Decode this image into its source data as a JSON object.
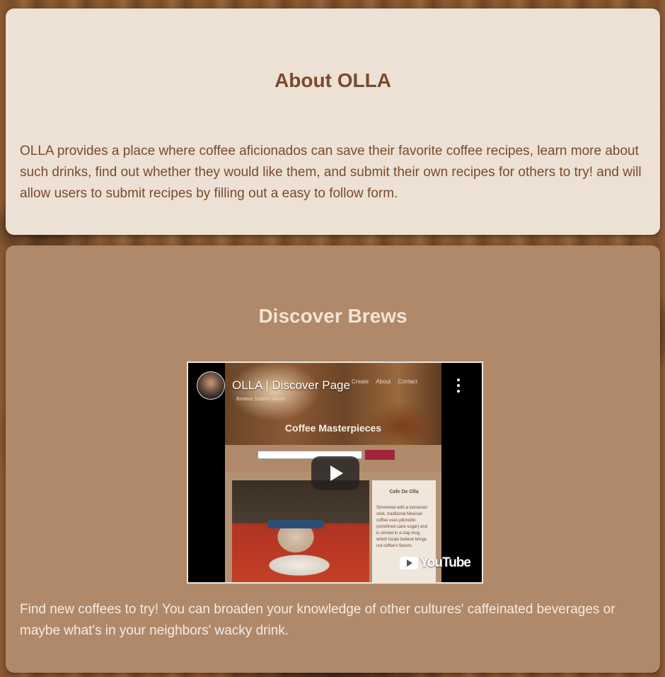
{
  "about": {
    "title": "About OLLA",
    "body": "OLLA provides a place where coffee aficionados can save their favorite coffee recipes, learn more about such drinks, find out whether they would like them, and submit their own recipes for others to try! and will allow users to submit recipes by filling out a easy to follow form."
  },
  "discover": {
    "title": "Discover Brews",
    "body": "Find new coffees to try! You can broaden your knowledge of other cultures' caffeinated beverages or maybe what's in your neighbors' wacky drink.",
    "video": {
      "title": "OLLA | Discover Page",
      "logo_text": "YouTube",
      "embedded_page": {
        "nav": [
          "Create",
          "About",
          "Contact"
        ],
        "subnav": "Browse  Submit  Saved",
        "heading": "Coffee Masterpieces",
        "search_button": "🔍",
        "card_title": "Cafe De Olla",
        "card_text": "Simmered with a cinnamon stick, traditional Mexican coffee uses piloncillo (unrefined cane sugar) and is served in a clay mug, which locals believe brings out coffee's flavors."
      }
    }
  },
  "colors": {
    "about_bg": "#ede1d5",
    "about_text": "#7a4a2c",
    "discover_bg": "#b0896a",
    "discover_text": "#f6ebe1"
  }
}
